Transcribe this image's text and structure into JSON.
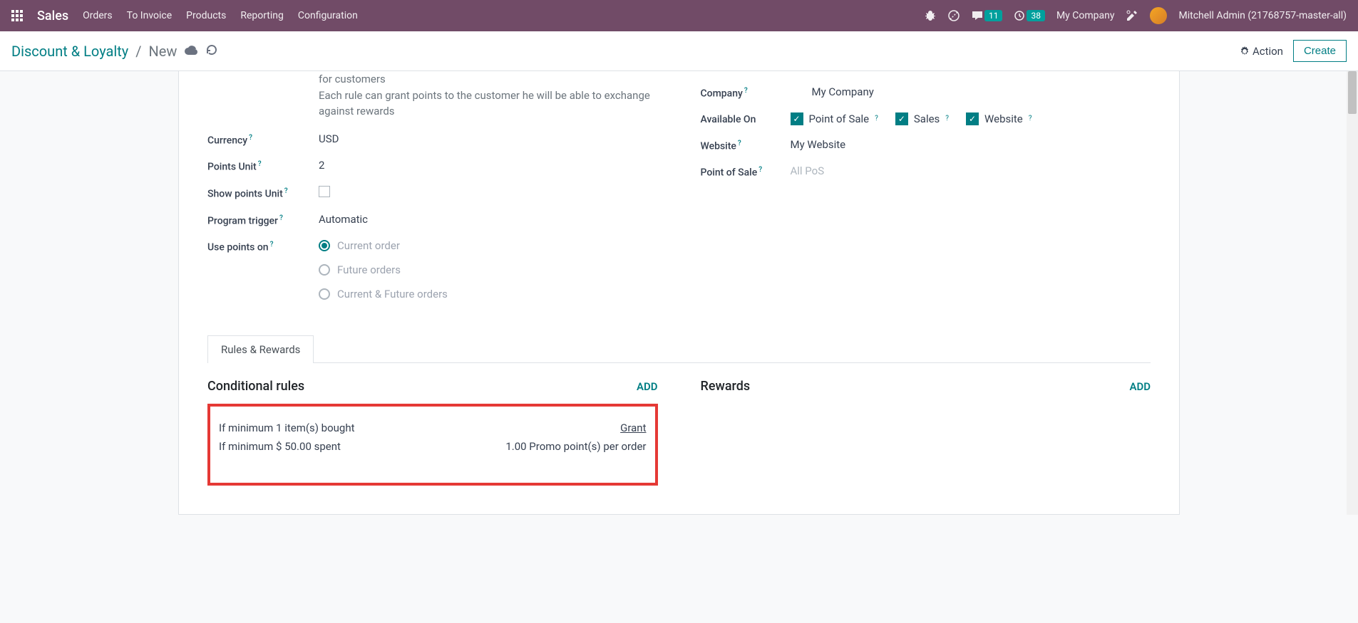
{
  "navbar": {
    "brand": "Sales",
    "menu": [
      "Orders",
      "To Invoice",
      "Products",
      "Reporting",
      "Configuration"
    ],
    "messages_badge": "11",
    "activities_badge": "38",
    "company": "My Company",
    "user": "Mitchell Admin (21768757-master-all)"
  },
  "breadcrumb": {
    "parent": "Discount & Loyalty",
    "current": "New",
    "action_label": "Action",
    "create_label": "Create"
  },
  "form": {
    "help_text1": "for customers",
    "help_text2": "Each rule can grant points to the customer he will be able to exchange against rewards",
    "currency_label": "Currency",
    "currency_value": "USD",
    "points_unit_label": "Points Unit",
    "points_unit_value": "2",
    "show_points_unit_label": "Show points Unit",
    "program_trigger_label": "Program trigger",
    "program_trigger_value": "Automatic",
    "use_points_on_label": "Use points on",
    "use_points_options": [
      "Current order",
      "Future orders",
      "Current & Future orders"
    ],
    "company_label": "Company",
    "company_value": "My Company",
    "available_on_label": "Available On",
    "available_on_options": [
      "Point of Sale",
      "Sales",
      "Website"
    ],
    "website_label": "Website",
    "website_value": "My Website",
    "pos_label": "Point of Sale",
    "pos_placeholder": "All PoS"
  },
  "tabs": {
    "rules_rewards": "Rules & Rewards"
  },
  "sections": {
    "conditional_rules_title": "Conditional rules",
    "rewards_title": "Rewards",
    "add_label": "ADD"
  },
  "rule": {
    "line1": "If minimum 1 item(s) bought",
    "line2": "If minimum $ 50.00 spent",
    "grant_label": "Grant",
    "grant_value": "1.00 Promo point(s) per order"
  }
}
